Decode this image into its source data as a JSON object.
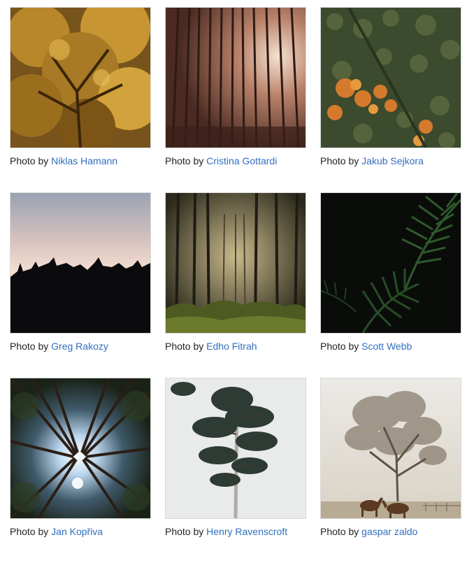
{
  "gallery": {
    "caption_prefix": "Photo by",
    "items": [
      {
        "photographer": "Niklas Hamann",
        "subject": "autumn-tree-canopy"
      },
      {
        "photographer": "Cristina Gottardi",
        "subject": "tall-pine-forest-sunlight"
      },
      {
        "photographer": "Jakub Sejkora",
        "subject": "aerial-autumn-forest"
      },
      {
        "photographer": "Greg Rakozy",
        "subject": "treeline-silhouette-dusk"
      },
      {
        "photographer": "Edho Fitrah",
        "subject": "misty-forest-undergrowth"
      },
      {
        "photographer": "Scott Webb",
        "subject": "palm-fronds-dark"
      },
      {
        "photographer": "Jan Kopřiva",
        "subject": "looking-up-pine-trees"
      },
      {
        "photographer": "Henry Ravenscroft",
        "subject": "lone-pine-tree"
      },
      {
        "photographer": "gaspar zaldo",
        "subject": "foggy-tree-with-horses"
      }
    ]
  },
  "colors": {
    "link": "#2f6fbf",
    "text": "#222222",
    "border": "#d9d9d9"
  }
}
